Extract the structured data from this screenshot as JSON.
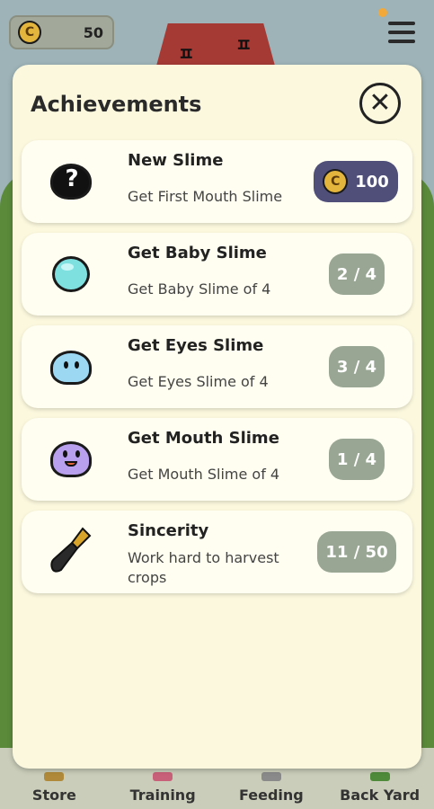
{
  "top_bar": {
    "coin_symbol": "C",
    "coin_amount": "50"
  },
  "dialog": {
    "title": "Achievements",
    "close_symbol": "✕"
  },
  "achievements": [
    {
      "name": "New Slime",
      "desc": "Get First Mouth Slime",
      "status_type": "reward",
      "reward_amount": "100",
      "icon": "question-slime-icon"
    },
    {
      "name": "Get Baby Slime",
      "desc": "Get Baby Slime of 4",
      "status_type": "progress",
      "progress": "2 / 4",
      "icon": "baby-slime-icon"
    },
    {
      "name": "Get Eyes Slime",
      "desc": "Get Eyes Slime of 4",
      "status_type": "progress",
      "progress": "3 / 4",
      "icon": "eyes-slime-icon"
    },
    {
      "name": "Get Mouth Slime",
      "desc": "Get Mouth Slime of 4",
      "status_type": "progress",
      "progress": "1 / 4",
      "icon": "mouth-slime-icon"
    },
    {
      "name": "Sincerity",
      "desc": "Work hard to harvest crops",
      "status_type": "progress",
      "progress": "11 / 50",
      "icon": "trowel-icon"
    }
  ],
  "bottom_nav": {
    "items": [
      {
        "label": "Store"
      },
      {
        "label": "Training"
      },
      {
        "label": "Feeding"
      },
      {
        "label": "Back Yard"
      }
    ]
  },
  "colors": {
    "dialog_bg": "#fbf8de",
    "card_bg": "#fffef0",
    "progress_badge": "#9aa694",
    "reward_badge": "#4f4f7a",
    "coin": "#e3b53c",
    "notification_dot": "#f2a93a"
  }
}
